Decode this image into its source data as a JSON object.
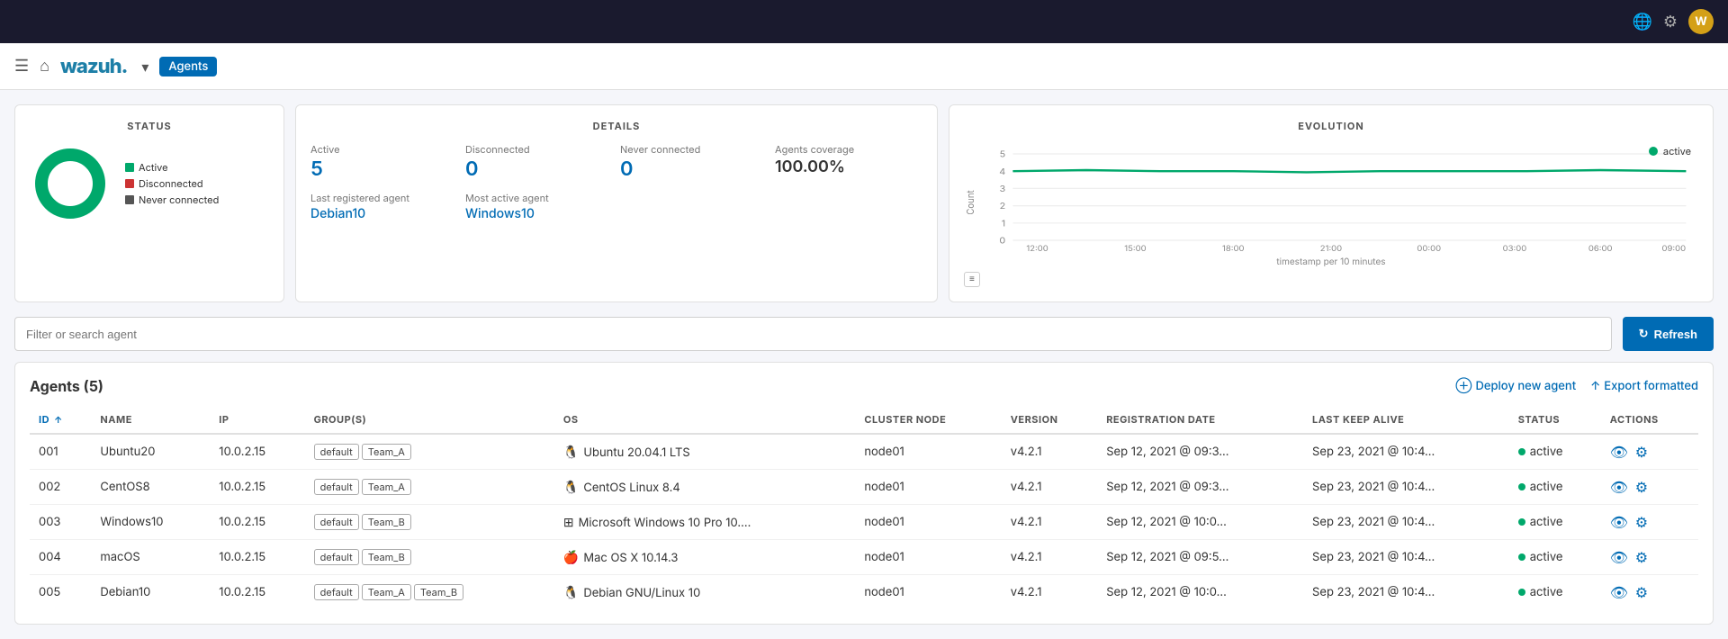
{
  "topbar": {
    "icons": [
      "globe-icon",
      "settings-icon"
    ],
    "avatar_label": "W"
  },
  "navbar": {
    "logo_text": "wazuh.",
    "dropdown_label": "▾",
    "tag_label": "Agents"
  },
  "status_card": {
    "title": "STATUS",
    "legend": [
      {
        "label": "Active",
        "color": "#00a86b"
      },
      {
        "label": "Disconnected",
        "color": "#cc3333"
      },
      {
        "label": "Never connected",
        "color": "#555"
      }
    ]
  },
  "details_card": {
    "title": "DETAILS",
    "active_label": "Active",
    "active_value": "5",
    "disconnected_label": "Disconnected",
    "disconnected_value": "0",
    "never_connected_label": "Never connected",
    "never_connected_value": "0",
    "coverage_label": "Agents coverage",
    "coverage_value": "100.00%",
    "last_agent_label": "Last registered agent",
    "last_agent_value": "Debian10",
    "most_active_label": "Most active agent",
    "most_active_value": "Windows10"
  },
  "evolution_card": {
    "title": "EVOLUTION",
    "legend_label": "active",
    "x_label": "timestamp per 10 minutes",
    "x_ticks": [
      "12:00",
      "15:00",
      "18:00",
      "21:00",
      "00:00",
      "03:00",
      "06:00",
      "09:00"
    ],
    "y_ticks": [
      "0",
      "1",
      "2",
      "3",
      "4",
      "5"
    ],
    "y_axis_label": "Count"
  },
  "filter_bar": {
    "placeholder": "Filter or search agent",
    "refresh_label": "Refresh"
  },
  "agents_section": {
    "title": "Agents (5)",
    "deploy_label": "Deploy new agent",
    "export_label": "Export formatted",
    "columns": [
      "ID ↑",
      "Name",
      "IP",
      "Group(s)",
      "OS",
      "Cluster node",
      "Version",
      "Registration date",
      "Last keep alive",
      "Status",
      "Actions"
    ],
    "rows": [
      {
        "id": "001",
        "name": "Ubuntu20",
        "ip": "10.0.2.15",
        "groups": [
          "default",
          "Team_A"
        ],
        "os_icon": "linux",
        "os": "Ubuntu 20.04.1 LTS",
        "cluster_node": "node01",
        "version": "v4.2.1",
        "registration_date": "Sep 12, 2021 @ 09:3...",
        "last_keep_alive": "Sep 23, 2021 @ 10:4...",
        "status": "active"
      },
      {
        "id": "002",
        "name": "CentOS8",
        "ip": "10.0.2.15",
        "groups": [
          "default",
          "Team_A"
        ],
        "os_icon": "linux",
        "os": "CentOS Linux 8.4",
        "cluster_node": "node01",
        "version": "v4.2.1",
        "registration_date": "Sep 12, 2021 @ 09:3...",
        "last_keep_alive": "Sep 23, 2021 @ 10:4...",
        "status": "active"
      },
      {
        "id": "003",
        "name": "Windows10",
        "ip": "10.0.2.15",
        "groups": [
          "default",
          "Team_B"
        ],
        "os_icon": "windows",
        "os": "Microsoft Windows 10 Pro 10....",
        "cluster_node": "node01",
        "version": "v4.2.1",
        "registration_date": "Sep 12, 2021 @ 10:0...",
        "last_keep_alive": "Sep 23, 2021 @ 10:4...",
        "status": "active"
      },
      {
        "id": "004",
        "name": "macOS",
        "ip": "10.0.2.15",
        "groups": [
          "default",
          "Team_B"
        ],
        "os_icon": "apple",
        "os": "Mac OS X 10.14.3",
        "cluster_node": "node01",
        "version": "v4.2.1",
        "registration_date": "Sep 12, 2021 @ 09:5...",
        "last_keep_alive": "Sep 23, 2021 @ 10:4...",
        "status": "active"
      },
      {
        "id": "005",
        "name": "Debian10",
        "ip": "10.0.2.15",
        "groups": [
          "default",
          "Team_A",
          "Team_B"
        ],
        "os_icon": "linux",
        "os": "Debian GNU/Linux 10",
        "cluster_node": "node01",
        "version": "v4.2.1",
        "registration_date": "Sep 12, 2021 @ 10:0...",
        "last_keep_alive": "Sep 23, 2021 @ 10:4...",
        "status": "active"
      }
    ]
  }
}
